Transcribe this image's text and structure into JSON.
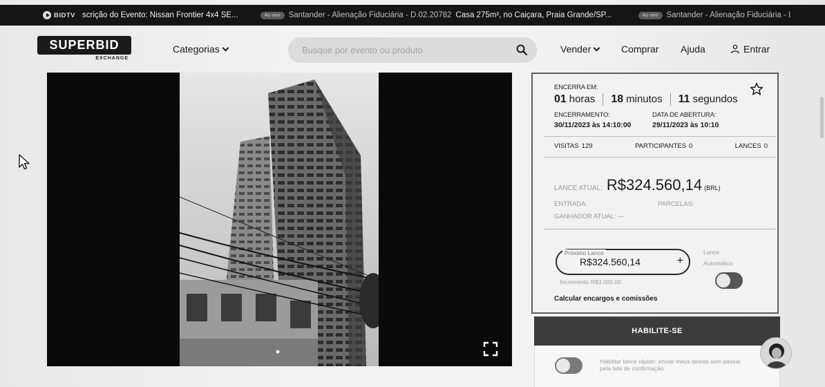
{
  "ticker": {
    "brand": "BIDTV",
    "items": [
      {
        "badge": "",
        "text": "scrição do Evento: Nissan Frontier 4x4 SE..."
      },
      {
        "badge": "Ao vivo",
        "text": "Santander - Alienação Fiduciária - D.02.20782"
      },
      {
        "badge": "",
        "text": "Casa 275m², no Caiçara, Praia Grande/SP..."
      },
      {
        "badge": "Ao vivo",
        "text": "Santander - Alienação Fiduciária - I"
      }
    ]
  },
  "header": {
    "logo": "SUPERBID",
    "logo_sub": "EXCHANGE",
    "categories": "Categorias",
    "search_placeholder": "Busque por evento ou produto",
    "vender": "Vender",
    "comprar": "Comprar",
    "ajuda": "Ajuda",
    "entrar": "Entrar"
  },
  "auction": {
    "ends_in_label": "ENCERRA EM:",
    "hours_value": "01",
    "hours_unit": "horas",
    "minutes_value": "18",
    "minutes_unit": "minutos",
    "seconds_value": "11",
    "seconds_unit": "segundos",
    "closing_label": "ENCERRAMENTO:",
    "closing_value": "30/11/2023 às 14:10:00",
    "opening_label": "DATA DE ABERTURA:",
    "opening_value": "29/11/2023 às 10:10",
    "visits_label": "VISITAS",
    "visits_value": "129",
    "participants_label": "PARTICIPANTES",
    "participants_value": "0",
    "bids_label": "LANCES",
    "bids_value": "0",
    "current_bid_label": "LANCE ATUAL:",
    "current_bid_value": "R$324.560,14",
    "currency": "(BRL)",
    "entrada_label": "ENTRADA:",
    "parcelas_label": "PARCELAS:",
    "winner_label": "GANHADOR ATUAL:",
    "winner_value": "---",
    "next_bid_label": "Próximo Lance",
    "next_bid_value": "R$324.560,14",
    "increment": "Incremento R$3.000,00",
    "auto_label_1": "Lance",
    "auto_label_2": "Automático",
    "calc_link": "Calcular encargos e comissões"
  },
  "habilite": {
    "button": "HABILITE-SE",
    "quick_text": "Habilitar lance rápido: enviar meus lances sem passar pela tela de confirmação"
  },
  "colors": {
    "ticker_bg": "#151515",
    "button_dark": "#3c3c3c",
    "card_border": "#5d5d5d"
  }
}
